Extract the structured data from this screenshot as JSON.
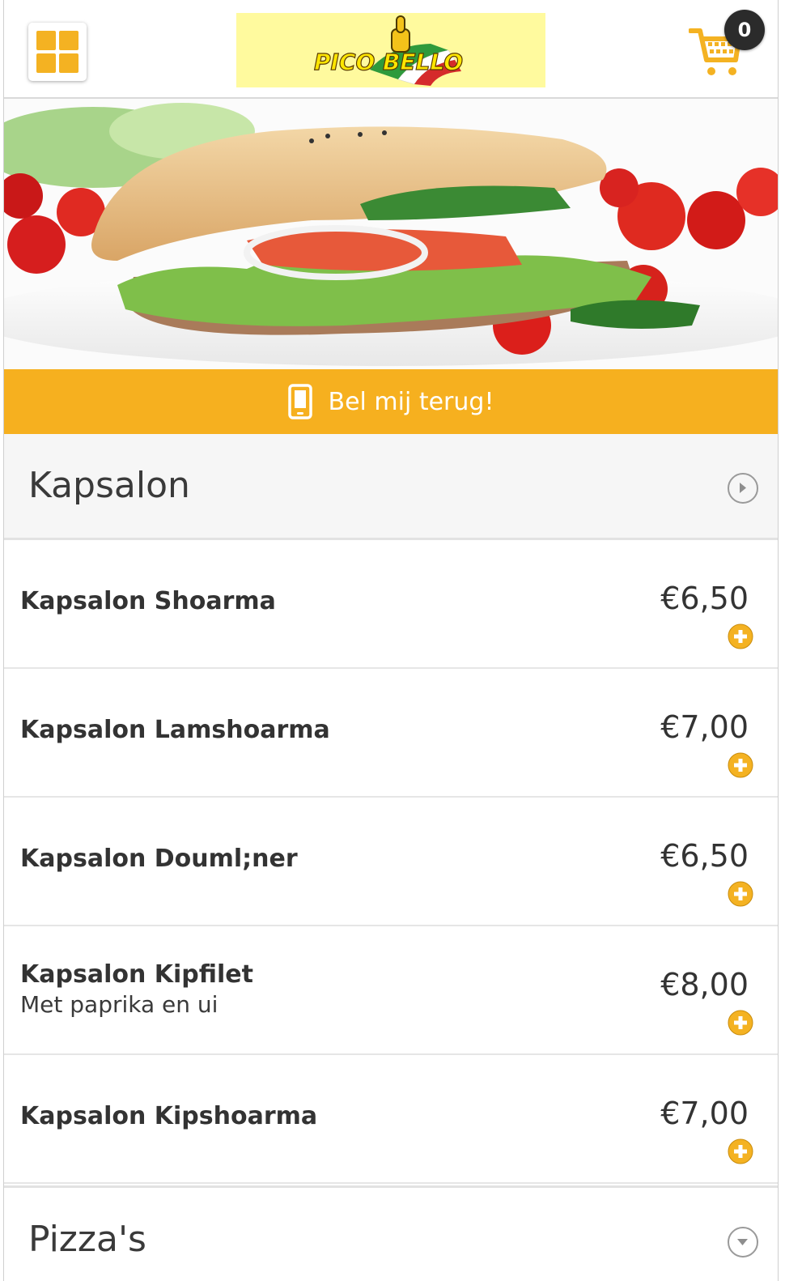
{
  "header": {
    "menu_icon": "grid-menu-icon",
    "logo_text": "PICO BELLO",
    "cart_icon": "shopping-cart-icon",
    "cart_count": "0"
  },
  "callback": {
    "icon": "mobile-phone-icon",
    "label": "Bel mij terug!"
  },
  "colors": {
    "accent": "#f6b01f",
    "badge": "#2b2b2b"
  },
  "categories": [
    {
      "title": "Kapsalon",
      "state_icon": "circle-arrow-right-icon",
      "items": [
        {
          "name": "Kapsalon Shoarma",
          "description": "",
          "price": "€6,50"
        },
        {
          "name": "Kapsalon Lamshoarma",
          "description": "",
          "price": "€7,00"
        },
        {
          "name": "Kapsalon Douml;ner",
          "description": "",
          "price": "€6,50"
        },
        {
          "name": "Kapsalon Kipfilet",
          "description": "Met paprika en ui",
          "price": "€8,00"
        },
        {
          "name": "Kapsalon Kipshoarma",
          "description": "",
          "price": "€7,00"
        }
      ]
    },
    {
      "title": "Pizza's",
      "state_icon": "circle-arrow-down-icon",
      "items": []
    }
  ]
}
